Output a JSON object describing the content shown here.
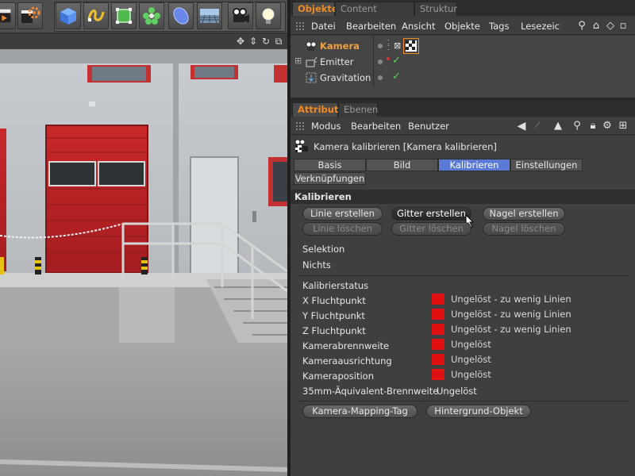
{
  "object_manager": {
    "tabs": [
      "Objekte",
      "Content Browser",
      "Struktur"
    ],
    "menu": [
      "Datei",
      "Bearbeiten",
      "Ansicht",
      "Objekte",
      "Tags",
      "Lesezeic"
    ],
    "objects": [
      {
        "name": "Kamera",
        "selected": true
      },
      {
        "name": "Emitter",
        "selected": false
      },
      {
        "name": "Gravitation",
        "selected": false
      }
    ]
  },
  "attribute_manager": {
    "tabs": [
      "Attribute",
      "Ebenen"
    ],
    "menu": [
      "Modus",
      "Bearbeiten",
      "Benutzer"
    ],
    "title": "Kamera kalibrieren [Kamera kalibrieren]",
    "subtabs": [
      "Basis",
      "Bild",
      "Kalibrieren",
      "Einstellungen",
      "Verknüpfungen"
    ],
    "active_subtab": "Kalibrieren",
    "section_title": "Kalibrieren",
    "buttons_row1": [
      "Linie erstellen",
      "Gitter erstellen",
      "Nagel erstellen"
    ],
    "buttons_row2": [
      "Linie löschen",
      "Gitter löschen",
      "Nagel löschen"
    ],
    "selection_label": "Selektion",
    "selection_value": "Nichts",
    "status_header": "Kalibrierstatus",
    "status_rows": [
      {
        "label": "X Fluchtpunkt",
        "value": "Ungelöst - zu wenig Linien",
        "color": "#e01010"
      },
      {
        "label": "Y Fluchtpunkt",
        "value": "Ungelöst - zu wenig Linien",
        "color": "#e01010"
      },
      {
        "label": "Z Fluchtpunkt",
        "value": "Ungelöst - zu wenig Linien",
        "color": "#e01010"
      },
      {
        "label": "Kamerabrennweite",
        "value": "Ungelöst",
        "color": "#e01010"
      },
      {
        "label": "Kameraausrichtung",
        "value": "Ungelöst",
        "color": "#e01010"
      },
      {
        "label": "Kameraposition",
        "value": "Ungelöst",
        "color": "#e01010"
      }
    ],
    "equiv_label": "35mm-Äquivalent-Brennweite",
    "equiv_value": "Ungelöst",
    "bottom_buttons": [
      "Kamera-Mapping-Tag",
      "Hintergrund-Objekt"
    ]
  },
  "toolbar_icons": [
    "play-clapper-icon",
    "render-settings-icon",
    "cube-icon",
    "spline-icon",
    "subdivision-icon",
    "cloner-icon",
    "deformer-icon",
    "floor-icon",
    "camera-icon",
    "light-icon"
  ],
  "colors": {
    "accent_orange": "#f08a22",
    "active_tab_blue": "#5a7ad6",
    "status_red": "#e01010"
  }
}
